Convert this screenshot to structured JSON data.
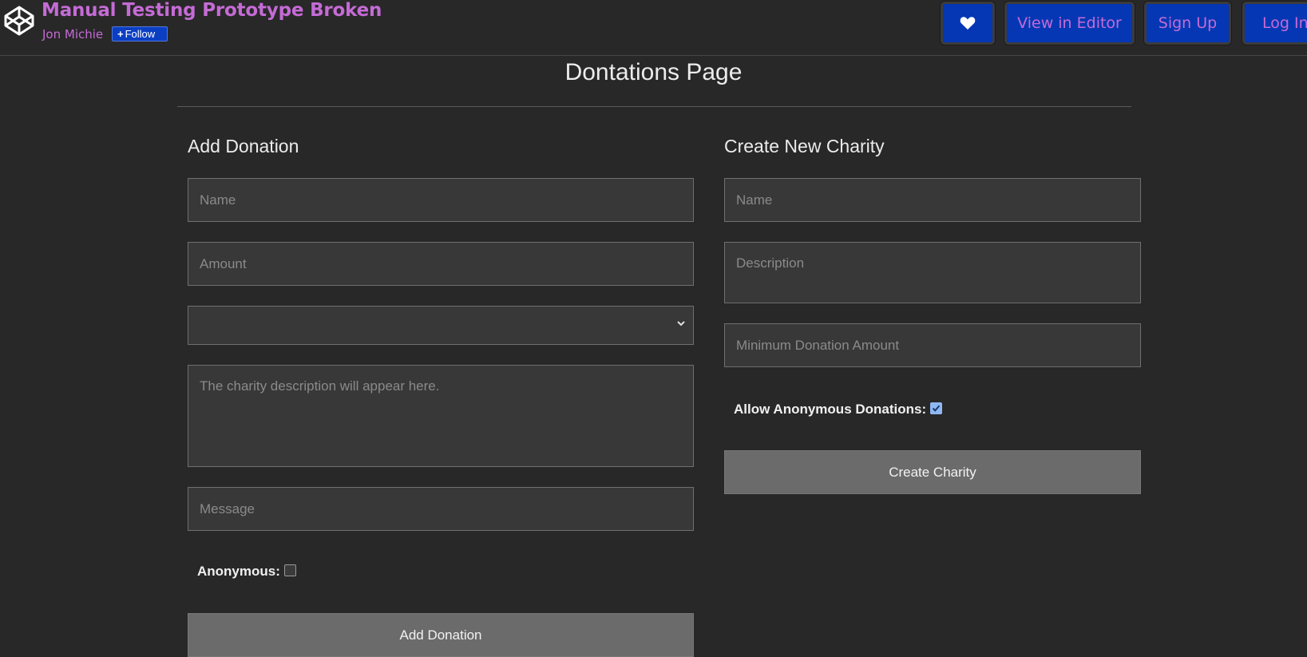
{
  "header": {
    "pen_title": "Manual Testing Prototype Broken",
    "author": "Jon Michie",
    "follow_label": "Follow",
    "buttons": {
      "heart_icon": "heart-icon",
      "view_in_editor": "View in Editor",
      "sign_up": "Sign Up",
      "log_in": "Log In"
    },
    "colors": {
      "brand_purple": "#c56bd6",
      "button_blue": "#0537b4"
    }
  },
  "page": {
    "title": "Dontations Page"
  },
  "add_donation": {
    "heading": "Add Donation",
    "name_placeholder": "Name",
    "amount_placeholder": "Amount",
    "charity_select_value": "",
    "description_placeholder": "The charity description will appear here.",
    "message_placeholder": "Message",
    "anonymous_label": "Anonymous:",
    "anonymous_checked": false,
    "submit_label": "Add Donation"
  },
  "create_charity": {
    "heading": "Create New Charity",
    "name_placeholder": "Name",
    "description_placeholder": "Description",
    "minimum_placeholder": "Minimum Donation Amount",
    "allow_anonymous_label": "Allow Anonymous Donations:",
    "allow_anonymous_checked": true,
    "submit_label": "Create Charity"
  }
}
